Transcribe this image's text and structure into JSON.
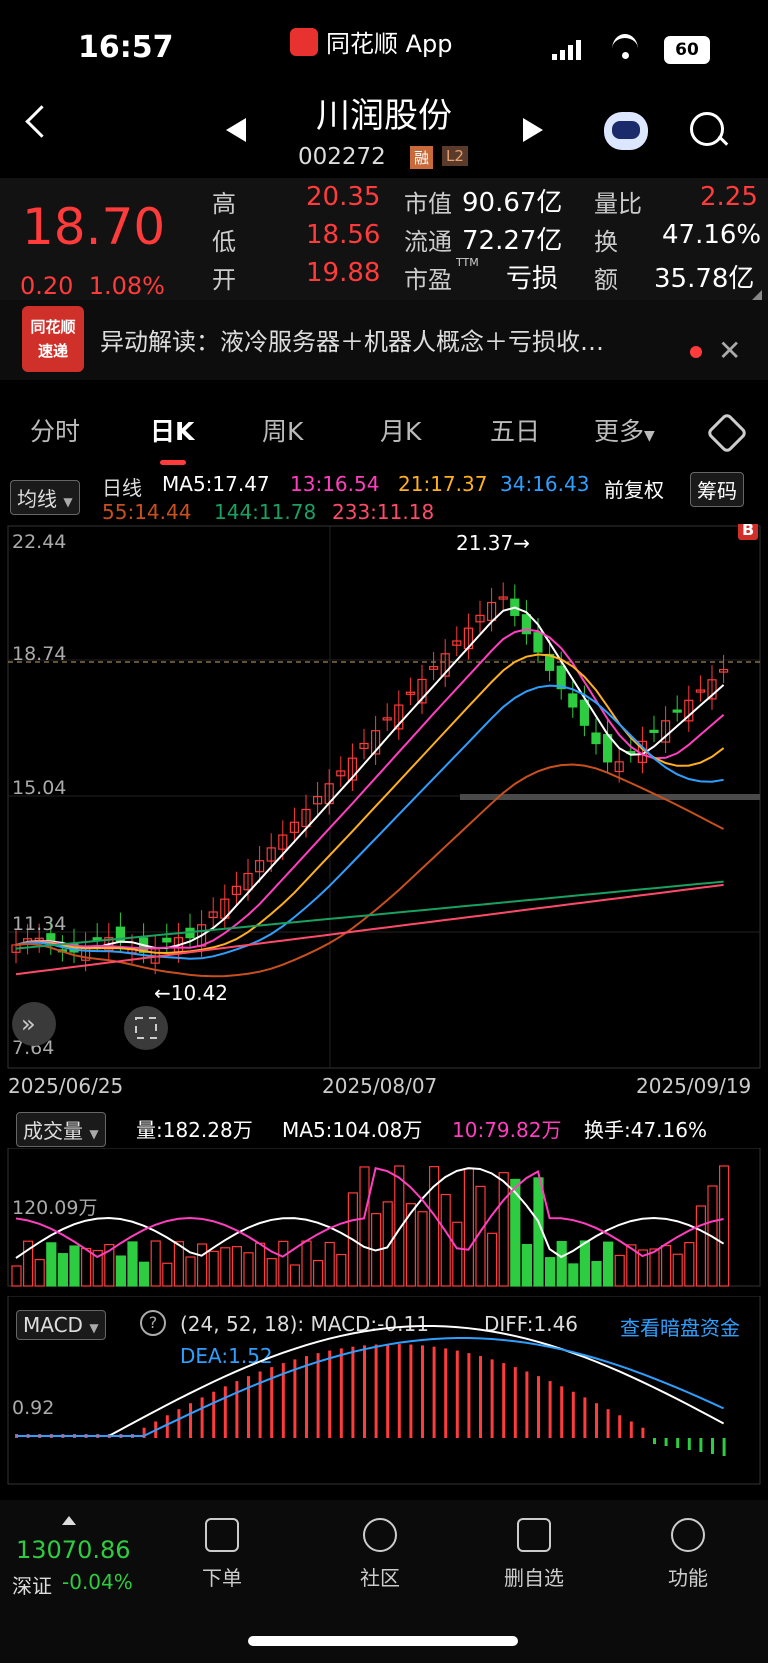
{
  "status": {
    "time": "16:57",
    "app": "同花顺 App",
    "battery": "60"
  },
  "header": {
    "name": "川润股份",
    "code": "002272",
    "tags": [
      "融",
      "L2"
    ]
  },
  "quote": {
    "price": "18.70",
    "change": "0.20",
    "change_pct": "1.08%",
    "high_label": "高",
    "high": "20.35",
    "low_label": "低",
    "low": "18.56",
    "open_label": "开",
    "open": "19.88",
    "mcap_label": "市值",
    "mcap": "90.67亿",
    "float_label": "流通",
    "float": "72.27亿",
    "pe_label": "市盈",
    "pe_sup": "TTM",
    "pe": "亏损",
    "vr_label": "量比",
    "vr": "2.25",
    "turn_label": "换",
    "turn": "47.16%",
    "amt_label": "额",
    "amt": "35.78亿"
  },
  "news": {
    "logo_top": "同花顺",
    "logo_bottom": "速递",
    "text": "异动解读：液冷服务器＋机器人概念＋亏损收…"
  },
  "tabs": [
    "分时",
    "日K",
    "周K",
    "月K",
    "五日",
    "更多"
  ],
  "ma_legend": {
    "selector": "均线",
    "day": "日线",
    "ma5": "MA5:17.47",
    "ma13": "13:16.54",
    "ma21": "21:17.37",
    "ma34": "34:16.43",
    "ma55": "55:14.44",
    "ma144": "144:11.78",
    "ma233": "233:11.18",
    "adjust": "前复权",
    "chips": "筹码"
  },
  "colors": {
    "up": "#ff3b3b",
    "down": "#2ecc40",
    "ma5": "#ffffff",
    "ma13": "#ff3fbf",
    "ma21": "#ffb020",
    "ma34": "#2f9fff",
    "ma55": "#c8501e",
    "ma144": "#1aa060",
    "ma233": "#ff4a6a"
  },
  "kline": {
    "y_labels": [
      "22.44",
      "18.74",
      "15.04",
      "11.34",
      "7.64"
    ],
    "dates": [
      "2025/06/25",
      "2025/08/07",
      "2025/09/19"
    ],
    "high_marker": "21.37→",
    "low_marker": "←10.42",
    "b_marker": "B"
  },
  "volume": {
    "selector": "成交量",
    "vol": "量:182.28万",
    "ma5": "MA5:104.08万",
    "ma10": "10:79.82万",
    "turnover": "换手:47.16%",
    "y_label": "120.09万"
  },
  "macd": {
    "selector": "MACD",
    "help": "?",
    "params": "(24, 52, 18): MACD:-0.11",
    "diff": "DIFF:1.46",
    "dea": "DEA:1.52",
    "link": "查看暗盘资金",
    "y_label": "0.92"
  },
  "bottom": {
    "index_value": "13070.86",
    "index_name": "深证",
    "index_change": "-0.04%",
    "nav": [
      "下单",
      "社区",
      "删自选",
      "功能"
    ]
  }
}
